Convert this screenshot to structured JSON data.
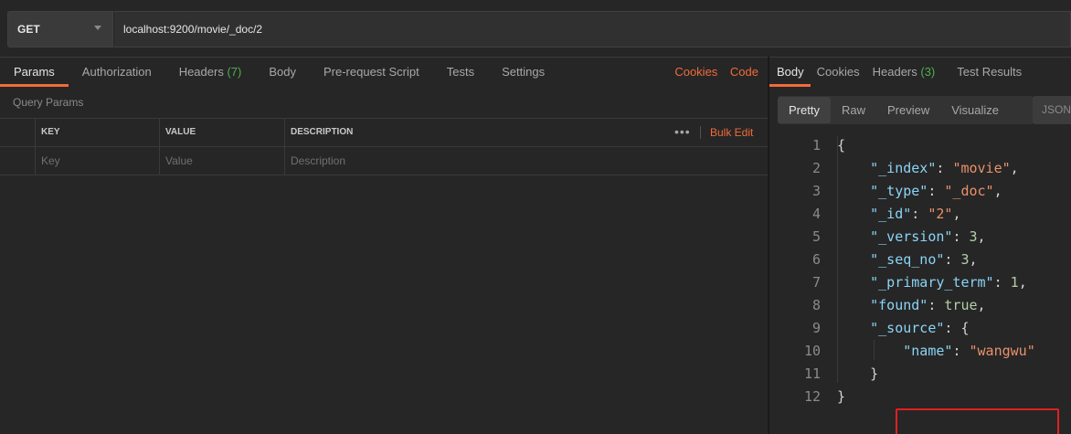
{
  "request": {
    "method": "GET",
    "url": "localhost:9200/movie/_doc/2"
  },
  "request_tabs": [
    {
      "label": "Params",
      "count": ""
    },
    {
      "label": "Authorization",
      "count": ""
    },
    {
      "label": "Headers",
      "count": "(7)"
    },
    {
      "label": "Body",
      "count": ""
    },
    {
      "label": "Pre-request Script",
      "count": ""
    },
    {
      "label": "Tests",
      "count": ""
    },
    {
      "label": "Settings",
      "count": ""
    }
  ],
  "request_links": {
    "cookies": "Cookies",
    "code": "Code"
  },
  "query_params": {
    "title": "Query Params",
    "columns": [
      "KEY",
      "VALUE",
      "DESCRIPTION"
    ],
    "more": "•••",
    "bulk_edit": "Bulk Edit",
    "placeholders": [
      "Key",
      "Value",
      "Description"
    ]
  },
  "response_tabs": [
    {
      "label": "Body",
      "count": ""
    },
    {
      "label": "Cookies",
      "count": ""
    },
    {
      "label": "Headers",
      "count": "(3)"
    },
    {
      "label": "Test Results",
      "count": ""
    }
  ],
  "view_modes": [
    "Pretty",
    "Raw",
    "Preview",
    "Visualize"
  ],
  "format": "JSON",
  "response_lines": [
    {
      "n": "1",
      "tokens": [
        {
          "t": "{",
          "c": "p"
        }
      ]
    },
    {
      "n": "2",
      "tokens": [
        {
          "t": "    ",
          "c": "p"
        },
        {
          "t": "\"_index\"",
          "c": "k"
        },
        {
          "t": ": ",
          "c": "p"
        },
        {
          "t": "\"movie\"",
          "c": "s"
        },
        {
          "t": ",",
          "c": "p"
        }
      ]
    },
    {
      "n": "3",
      "tokens": [
        {
          "t": "    ",
          "c": "p"
        },
        {
          "t": "\"_type\"",
          "c": "k"
        },
        {
          "t": ": ",
          "c": "p"
        },
        {
          "t": "\"_doc\"",
          "c": "s"
        },
        {
          "t": ",",
          "c": "p"
        }
      ]
    },
    {
      "n": "4",
      "tokens": [
        {
          "t": "    ",
          "c": "p"
        },
        {
          "t": "\"_id\"",
          "c": "k"
        },
        {
          "t": ": ",
          "c": "p"
        },
        {
          "t": "\"2\"",
          "c": "s"
        },
        {
          "t": ",",
          "c": "p"
        }
      ]
    },
    {
      "n": "5",
      "tokens": [
        {
          "t": "    ",
          "c": "p"
        },
        {
          "t": "\"_version\"",
          "c": "k"
        },
        {
          "t": ": ",
          "c": "p"
        },
        {
          "t": "3",
          "c": "n"
        },
        {
          "t": ",",
          "c": "p"
        }
      ]
    },
    {
      "n": "6",
      "tokens": [
        {
          "t": "    ",
          "c": "p"
        },
        {
          "t": "\"_seq_no\"",
          "c": "k"
        },
        {
          "t": ": ",
          "c": "p"
        },
        {
          "t": "3",
          "c": "n"
        },
        {
          "t": ",",
          "c": "p"
        }
      ]
    },
    {
      "n": "7",
      "tokens": [
        {
          "t": "    ",
          "c": "p"
        },
        {
          "t": "\"_primary_term\"",
          "c": "k"
        },
        {
          "t": ": ",
          "c": "p"
        },
        {
          "t": "1",
          "c": "n"
        },
        {
          "t": ",",
          "c": "p"
        }
      ]
    },
    {
      "n": "8",
      "tokens": [
        {
          "t": "    ",
          "c": "p"
        },
        {
          "t": "\"found\"",
          "c": "k"
        },
        {
          "t": ": ",
          "c": "p"
        },
        {
          "t": "true",
          "c": "n"
        },
        {
          "t": ",",
          "c": "p"
        }
      ]
    },
    {
      "n": "9",
      "tokens": [
        {
          "t": "    ",
          "c": "p"
        },
        {
          "t": "\"_source\"",
          "c": "k"
        },
        {
          "t": ": {",
          "c": "p"
        }
      ]
    },
    {
      "n": "10",
      "tokens": [
        {
          "t": "        ",
          "c": "p"
        },
        {
          "t": "\"name\"",
          "c": "k"
        },
        {
          "t": ": ",
          "c": "p"
        },
        {
          "t": "\"wangwu\"",
          "c": "s"
        }
      ]
    },
    {
      "n": "11",
      "tokens": [
        {
          "t": "    }",
          "c": "p"
        }
      ]
    },
    {
      "n": "12",
      "tokens": [
        {
          "t": "}",
          "c": "p"
        }
      ]
    }
  ],
  "colors": {
    "accent": "#f26b3a",
    "count": "#4fae4f",
    "highlight_box": "#e02020"
  }
}
